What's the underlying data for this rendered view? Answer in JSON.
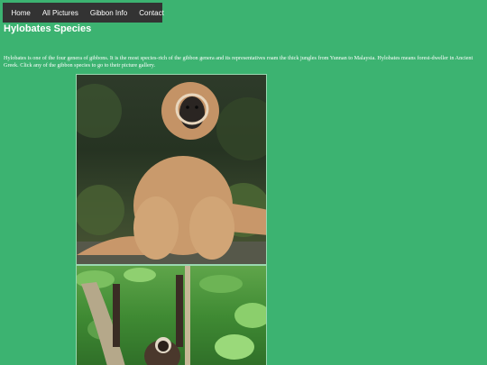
{
  "nav": {
    "items": [
      {
        "label": "Home"
      },
      {
        "label": "All Pictures"
      },
      {
        "label": "Gibbon Info"
      },
      {
        "label": "Contact"
      }
    ]
  },
  "page": {
    "title": "Hylobates Species",
    "intro": "Hylobates is one of the four genera of gibbons. It is the most species-rich of the gibbon genera and its representatives roam the thick jungles from Yunnan to Malaysia. Hylobates means forest-dweller in Ancient Greek. Click any of the gibbon species to go to their picture gallery."
  },
  "gallery": [
    {
      "subject": "lar-gibbon-sitting"
    },
    {
      "subject": "gibbon-hanging-in-jungle"
    }
  ]
}
